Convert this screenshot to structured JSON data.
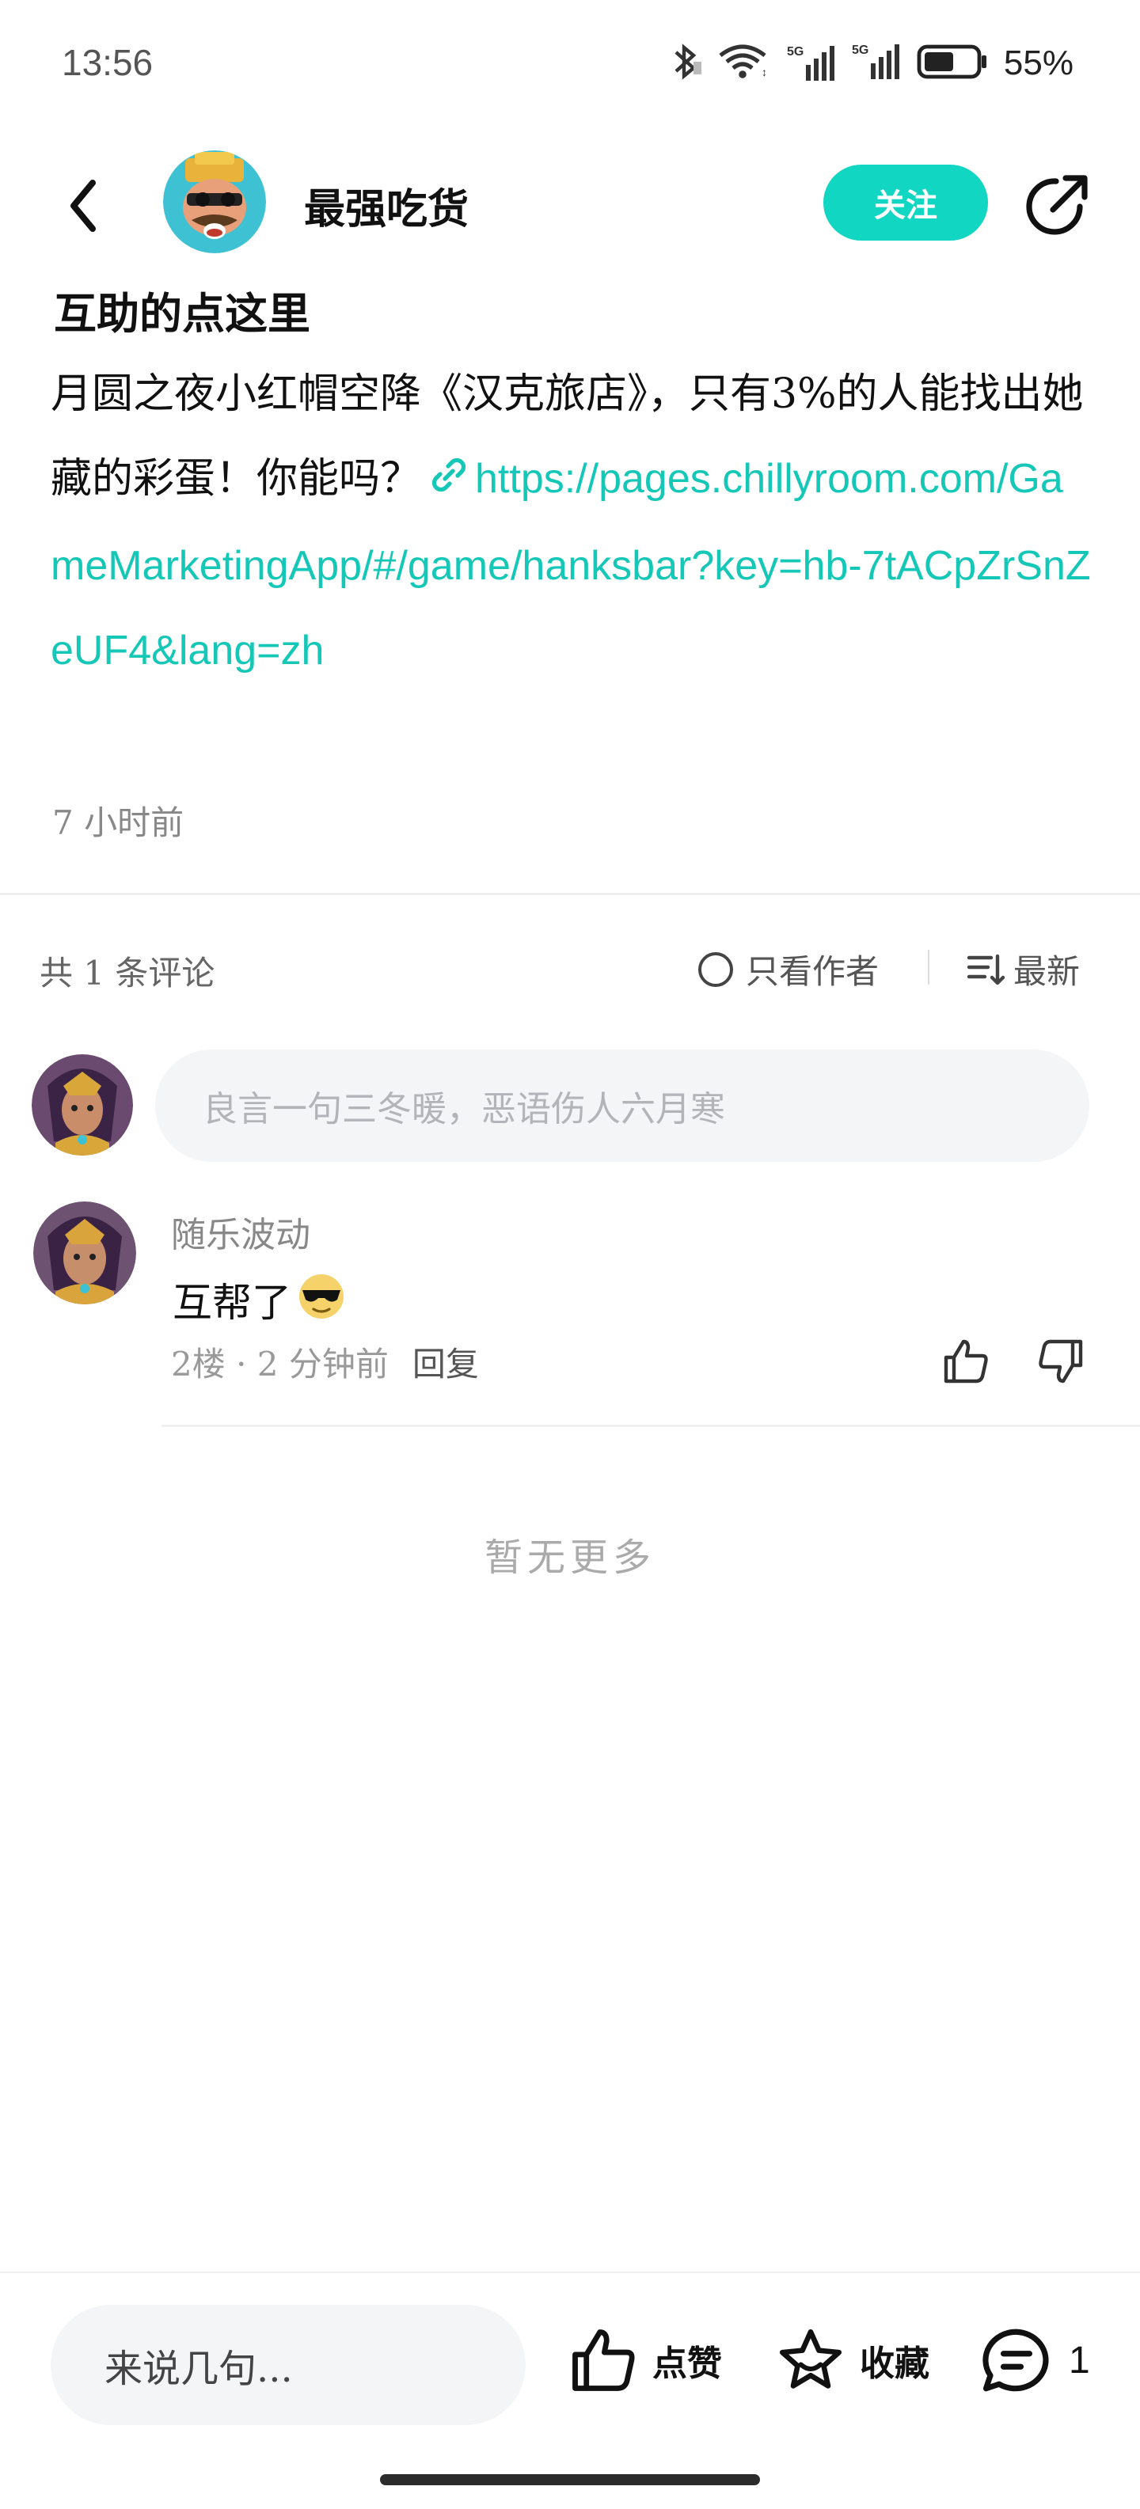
{
  "status_bar": {
    "time": "13:56",
    "battery": "55%",
    "signal_1_label": "5G",
    "signal_2_label": "5G"
  },
  "header": {
    "author_name": "最强吃货",
    "follow_label": "关注"
  },
  "post": {
    "title": "互助的点这里",
    "body_text": "月圆之夜小红帽空降《汉克旅店》，只有3%的人能找出她藏的彩蛋！你能吗？",
    "link_text": "https://pages.chillyroom.com/GameMarketingApp/#/game/hanksbar?key=hb-7tACpZrSnZeUF4&lang=zh",
    "time": "7 小时前"
  },
  "comments_section": {
    "count_label": "共 1 条评论",
    "author_only_label": "只看作者",
    "sort_label": "最新",
    "input_placeholder": "良言一句三冬暖，恶语伤人六月寒",
    "comments": [
      {
        "user": "随乐波动",
        "text": "互帮了",
        "floor_time": "2楼 · 2 分钟前",
        "reply_label": "回复"
      }
    ],
    "no_more_label": "暂无更多"
  },
  "bottom_bar": {
    "input_placeholder": "来说几句...",
    "like_label": "点赞",
    "collect_label": "收藏",
    "comment_count": "1"
  },
  "colors": {
    "accent": "#10d6c2",
    "link": "#14c7b7"
  },
  "icons": [
    "back-arrow-icon",
    "share-icon",
    "link-icon",
    "circle-radio-icon",
    "sort-icon",
    "thumbs-up-icon",
    "thumbs-down-icon",
    "star-icon",
    "comment-bubble-icon",
    "bluetooth-icon",
    "wifi-icon",
    "signal-icon",
    "battery-icon",
    "sunglasses-emoji"
  ]
}
